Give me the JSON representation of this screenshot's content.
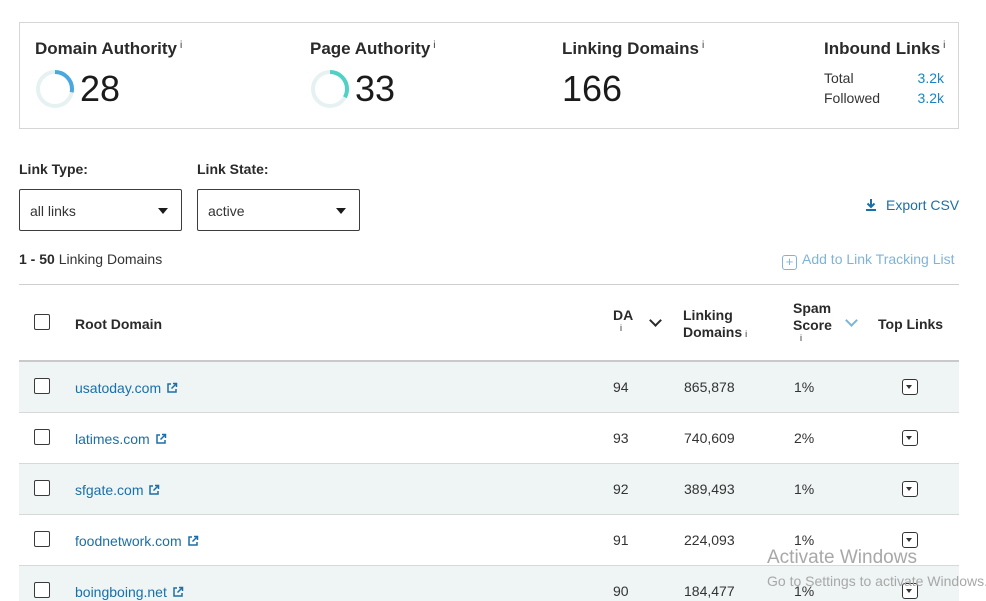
{
  "metrics": {
    "domain_authority": {
      "title": "Domain Authority",
      "info": "i",
      "value": "28",
      "gauge_fraction": 0.28
    },
    "page_authority": {
      "title": "Page Authority",
      "info": "i",
      "value": "33",
      "gauge_fraction": 0.33
    },
    "linking_domains": {
      "title": "Linking Domains",
      "info": "i",
      "value": "166"
    },
    "inbound_links": {
      "title": "Inbound Links",
      "info": "i",
      "total_label": "Total",
      "total_value": "3.2k",
      "followed_label": "Followed",
      "followed_value": "3.2k"
    },
    "gauge_colors": {
      "domain": "#4aa8e0",
      "page": "#4fd1c5",
      "track": "#e6f1f1"
    }
  },
  "filters": {
    "link_type": {
      "label": "Link Type:",
      "selected": "all links"
    },
    "link_state": {
      "label": "Link State:",
      "selected": "active"
    }
  },
  "actions": {
    "export_csv": "Export CSV",
    "add_to_tracking": "Add to Link Tracking List"
  },
  "results": {
    "range": "1 - 50",
    "range_label": "Linking Domains"
  },
  "table": {
    "headers": {
      "root_domain": "Root Domain",
      "da": "DA",
      "da_info": "i",
      "linking_domains_1": "Linking",
      "linking_domains_2": "Domains",
      "linking_info": "i",
      "spam_1": "Spam",
      "spam_2": "Score",
      "spam_info": "i",
      "top_links": "Top Links"
    },
    "rows": [
      {
        "domain": "usatoday.com",
        "da": "94",
        "linking_domains": "865,878",
        "spam": "1%"
      },
      {
        "domain": "latimes.com",
        "da": "93",
        "linking_domains": "740,609",
        "spam": "2%"
      },
      {
        "domain": "sfgate.com",
        "da": "92",
        "linking_domains": "389,493",
        "spam": "1%"
      },
      {
        "domain": "foodnetwork.com",
        "da": "91",
        "linking_domains": "224,093",
        "spam": "1%"
      },
      {
        "domain": "boingboing.net",
        "da": "90",
        "linking_domains": "184,477",
        "spam": "1%"
      }
    ]
  },
  "watermark": {
    "line1": "Activate Windows",
    "line2": "Go to Settings to activate Windows."
  }
}
